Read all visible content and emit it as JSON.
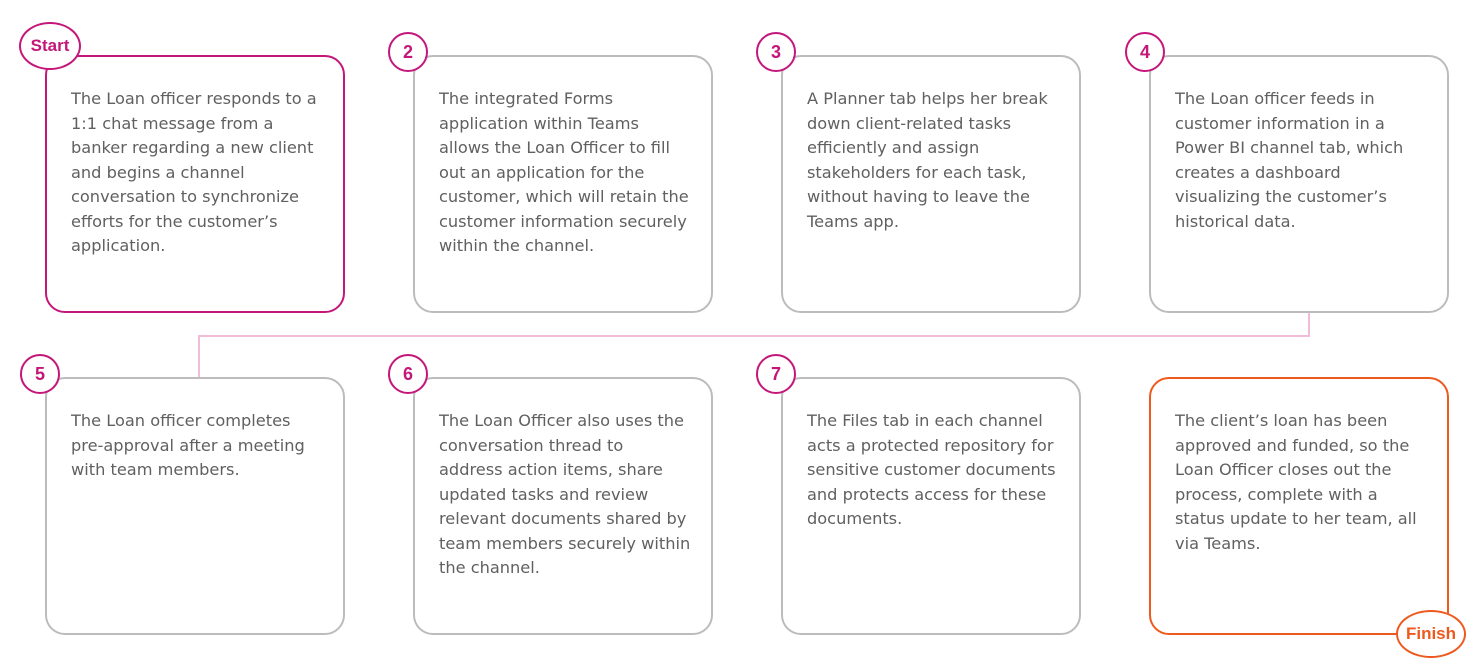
{
  "colors": {
    "start_accent": "#c4177a",
    "finish_accent": "#ee5a1e",
    "card_border": "#bcbcbc",
    "connector": "#f0bcd8",
    "text": "#606060"
  },
  "steps": [
    {
      "badge": "Start",
      "text": "The Loan officer responds to a 1:1 chat message from a banker regarding a new client and begins a channel conversation to synchronize efforts for the customer’s application."
    },
    {
      "badge": "2",
      "text": "The integrated Forms application within Teams allows the Loan Officer to fill out an application for the customer, which will retain the customer information securely within the channel."
    },
    {
      "badge": "3",
      "text": "A Planner tab helps her break down client-related tasks efficiently and assign stakeholders for each task, without having to leave the Teams app."
    },
    {
      "badge": "4",
      "text": "The Loan officer feeds in customer information in a Power BI channel tab, which creates a dashboard visualizing the customer’s historical data."
    },
    {
      "badge": "5",
      "text": "The Loan officer completes pre-approval after a meeting with team members."
    },
    {
      "badge": "6",
      "text": "The Loan Officer also uses the conversation thread to address action items, share updated tasks and review relevant documents shared by team members securely within the channel."
    },
    {
      "badge": "7",
      "text": "The Files tab in each channel acts a protected repository for sensitive customer documents and protects access for these documents."
    },
    {
      "badge": "Finish",
      "text": "The client’s loan has been approved and funded, so the Loan Officer closes out the process, complete with a status update to her team, all via Teams."
    }
  ]
}
